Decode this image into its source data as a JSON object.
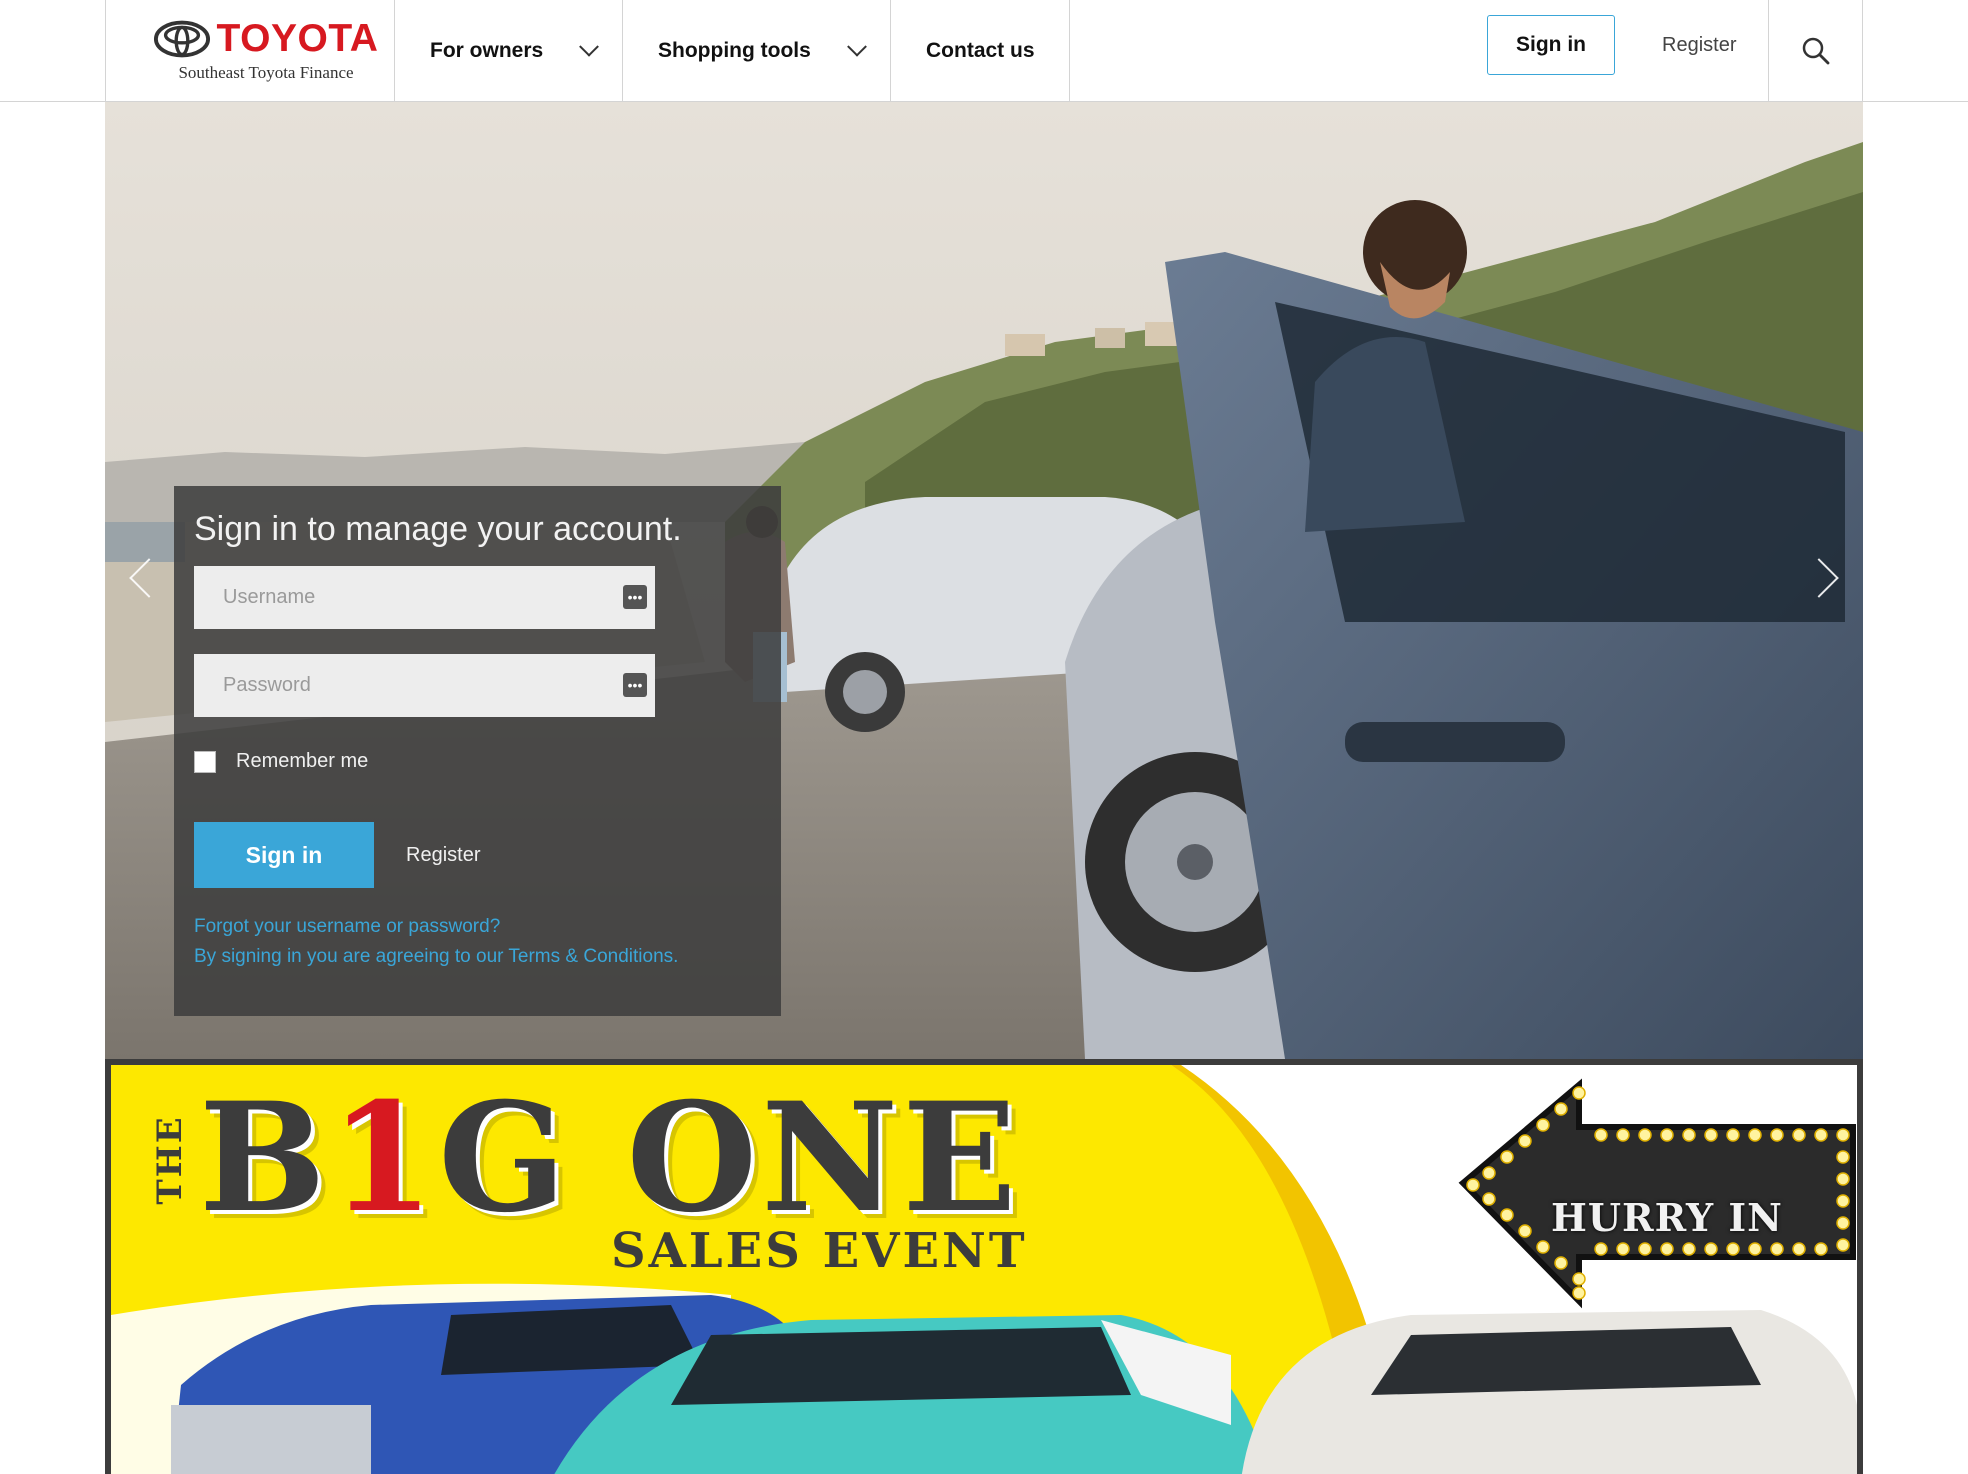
{
  "brand": {
    "name": "TOYOTA",
    "subtitle": "Southeast Toyota Finance",
    "color": "#d71920"
  },
  "nav": {
    "items": [
      {
        "label": "For owners",
        "has_dropdown": true
      },
      {
        "label": "Shopping tools",
        "has_dropdown": true
      },
      {
        "label": "Contact us",
        "has_dropdown": false
      }
    ],
    "sign_in": "Sign in",
    "register": "Register",
    "search_icon": "search-icon"
  },
  "login": {
    "title": "Sign in to manage your account.",
    "username_placeholder": "Username",
    "password_placeholder": "Password",
    "remember_label": "Remember me",
    "remember_checked": false,
    "sign_in": "Sign in",
    "register": "Register",
    "forgot": "Forgot your username or password?",
    "terms": "By signing in you are agreeing to our Terms & Conditions.",
    "field_badge": "•••"
  },
  "promo": {
    "the": "THE",
    "big_prefix": "B",
    "big_red": "1",
    "big_suffix": "G ONE",
    "sales": "SALES EVENT",
    "hurry": "HURRY IN"
  },
  "colors": {
    "accent": "#3aa6d8",
    "promo_yellow": "#fde800",
    "panel_bg": "rgba(60,60,60,0.86)"
  }
}
